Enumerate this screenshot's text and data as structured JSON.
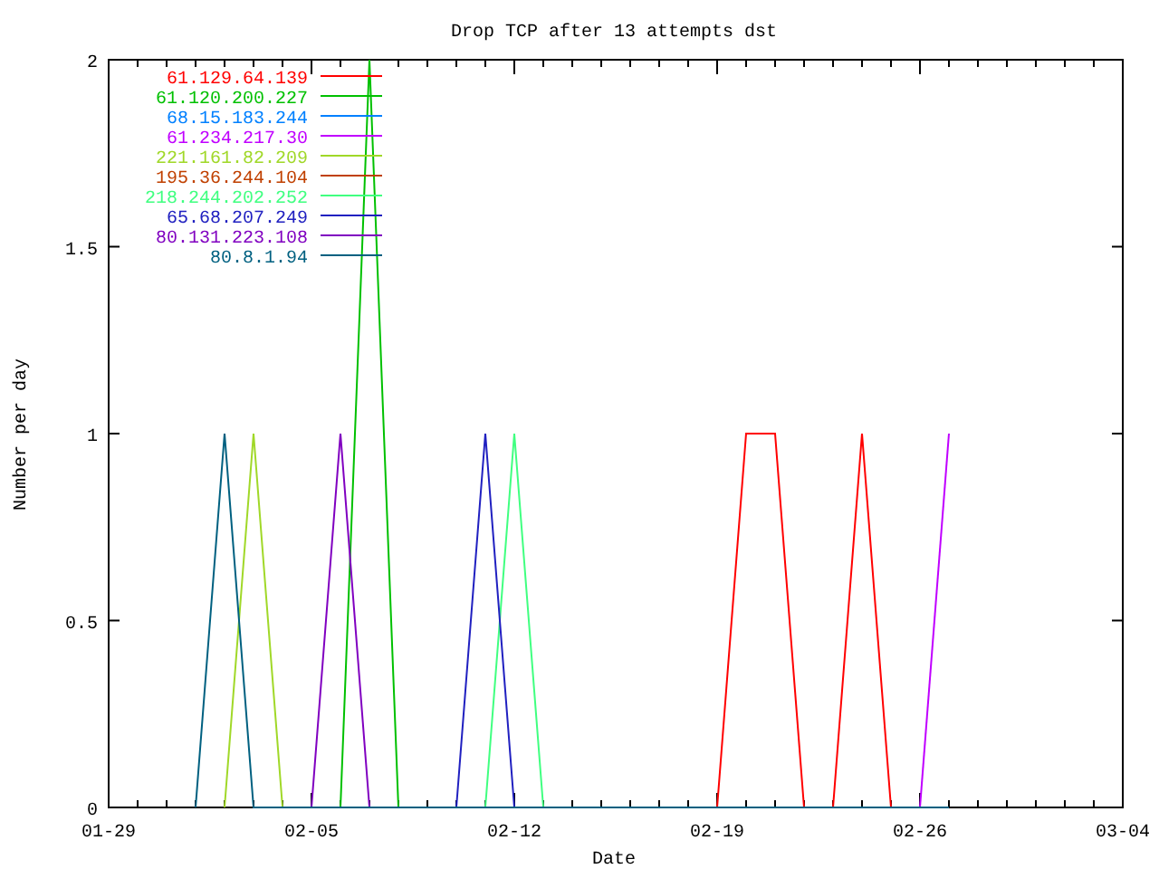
{
  "chart_data": {
    "type": "line",
    "title": "Drop TCP after 13 attempts dst",
    "xlabel": "Date",
    "ylabel": "Number per day",
    "categories": [
      "01-29",
      null,
      null,
      null,
      null,
      null,
      null,
      "02-05",
      null,
      null,
      null,
      null,
      null,
      null,
      "02-12",
      null,
      null,
      null,
      null,
      null,
      null,
      "02-19",
      null,
      null,
      null,
      null,
      null,
      null,
      "02-26",
      null,
      null,
      null,
      null,
      null,
      null,
      "03-04"
    ],
    "legend": true,
    "ylim": [
      0,
      2
    ],
    "yticks": [
      0,
      0.5,
      1,
      1.5,
      2
    ],
    "series": [
      {
        "name": "61.129.64.139",
        "color": "#ff0000",
        "values": [
          null,
          null,
          null,
          null,
          null,
          null,
          null,
          null,
          null,
          null,
          null,
          null,
          null,
          null,
          null,
          null,
          null,
          null,
          null,
          null,
          null,
          0,
          1,
          1,
          0,
          0,
          1,
          0,
          null,
          null,
          null,
          null,
          null,
          null,
          null,
          null
        ]
      },
      {
        "name": "61.120.200.227",
        "color": "#00c000",
        "values": [
          null,
          null,
          null,
          null,
          null,
          null,
          null,
          null,
          0,
          2,
          0,
          null,
          null,
          null,
          null,
          null,
          null,
          null,
          null,
          null,
          null,
          null,
          null,
          null,
          null,
          null,
          null,
          null,
          null,
          null,
          null,
          null,
          null,
          null,
          null,
          null
        ]
      },
      {
        "name": "68.15.183.244",
        "color": "#0080ff",
        "values": [
          null,
          null,
          null,
          null,
          null,
          null,
          null,
          null,
          null,
          null,
          null,
          null,
          null,
          null,
          null,
          null,
          null,
          null,
          null,
          null,
          null,
          null,
          null,
          null,
          null,
          null,
          null,
          null,
          null,
          null,
          null,
          null,
          null,
          null,
          null,
          null
        ]
      },
      {
        "name": "61.234.217.30",
        "color": "#c000ff",
        "values": [
          null,
          null,
          null,
          null,
          null,
          null,
          null,
          null,
          null,
          null,
          null,
          null,
          null,
          null,
          null,
          null,
          null,
          null,
          null,
          null,
          null,
          null,
          null,
          null,
          null,
          null,
          null,
          null,
          0,
          1,
          null,
          null,
          null,
          null,
          null,
          null
        ]
      },
      {
        "name": "221.161.82.209",
        "color": "#a0d828",
        "values": [
          null,
          null,
          null,
          null,
          0,
          1,
          0,
          null,
          null,
          null,
          null,
          null,
          null,
          null,
          null,
          null,
          null,
          null,
          null,
          null,
          null,
          null,
          null,
          null,
          null,
          null,
          null,
          null,
          null,
          null,
          null,
          null,
          null,
          null,
          null,
          null
        ]
      },
      {
        "name": "195.36.244.104",
        "color": "#c04000",
        "values": [
          null,
          null,
          null,
          null,
          null,
          null,
          null,
          null,
          null,
          null,
          null,
          null,
          null,
          null,
          null,
          null,
          null,
          null,
          null,
          null,
          null,
          null,
          null,
          null,
          null,
          null,
          null,
          null,
          null,
          null,
          null,
          null,
          null,
          null,
          null,
          null
        ]
      },
      {
        "name": "218.244.202.252",
        "color": "#40ff80",
        "values": [
          null,
          null,
          null,
          null,
          null,
          null,
          null,
          null,
          null,
          null,
          null,
          null,
          null,
          0,
          1,
          0,
          null,
          null,
          null,
          null,
          null,
          null,
          null,
          null,
          null,
          null,
          null,
          null,
          null,
          null,
          null,
          null,
          null,
          null,
          null,
          null
        ]
      },
      {
        "name": "65.68.207.249",
        "color": "#2020c0",
        "values": [
          null,
          null,
          null,
          null,
          null,
          null,
          null,
          null,
          null,
          null,
          null,
          null,
          0,
          1,
          0,
          null,
          null,
          null,
          null,
          null,
          null,
          null,
          null,
          null,
          null,
          null,
          null,
          null,
          null,
          null,
          null,
          null,
          null,
          null,
          null,
          null
        ]
      },
      {
        "name": "80.131.223.108",
        "color": "#8000c0",
        "values": [
          null,
          null,
          null,
          null,
          null,
          null,
          null,
          0,
          1,
          0,
          null,
          null,
          null,
          null,
          null,
          null,
          null,
          null,
          null,
          null,
          null,
          null,
          null,
          null,
          null,
          null,
          null,
          null,
          null,
          null,
          null,
          null,
          null,
          null,
          null,
          null
        ]
      },
      {
        "name": "80.8.1.94",
        "color": "#006080",
        "values": [
          null,
          null,
          null,
          0,
          1,
          0,
          0,
          0,
          0,
          0,
          0,
          0,
          0,
          0,
          0,
          0,
          0,
          0,
          0,
          0,
          0,
          0,
          0,
          0,
          0,
          0,
          0,
          0,
          0,
          0,
          null,
          null,
          null,
          null,
          null,
          null
        ]
      }
    ]
  }
}
